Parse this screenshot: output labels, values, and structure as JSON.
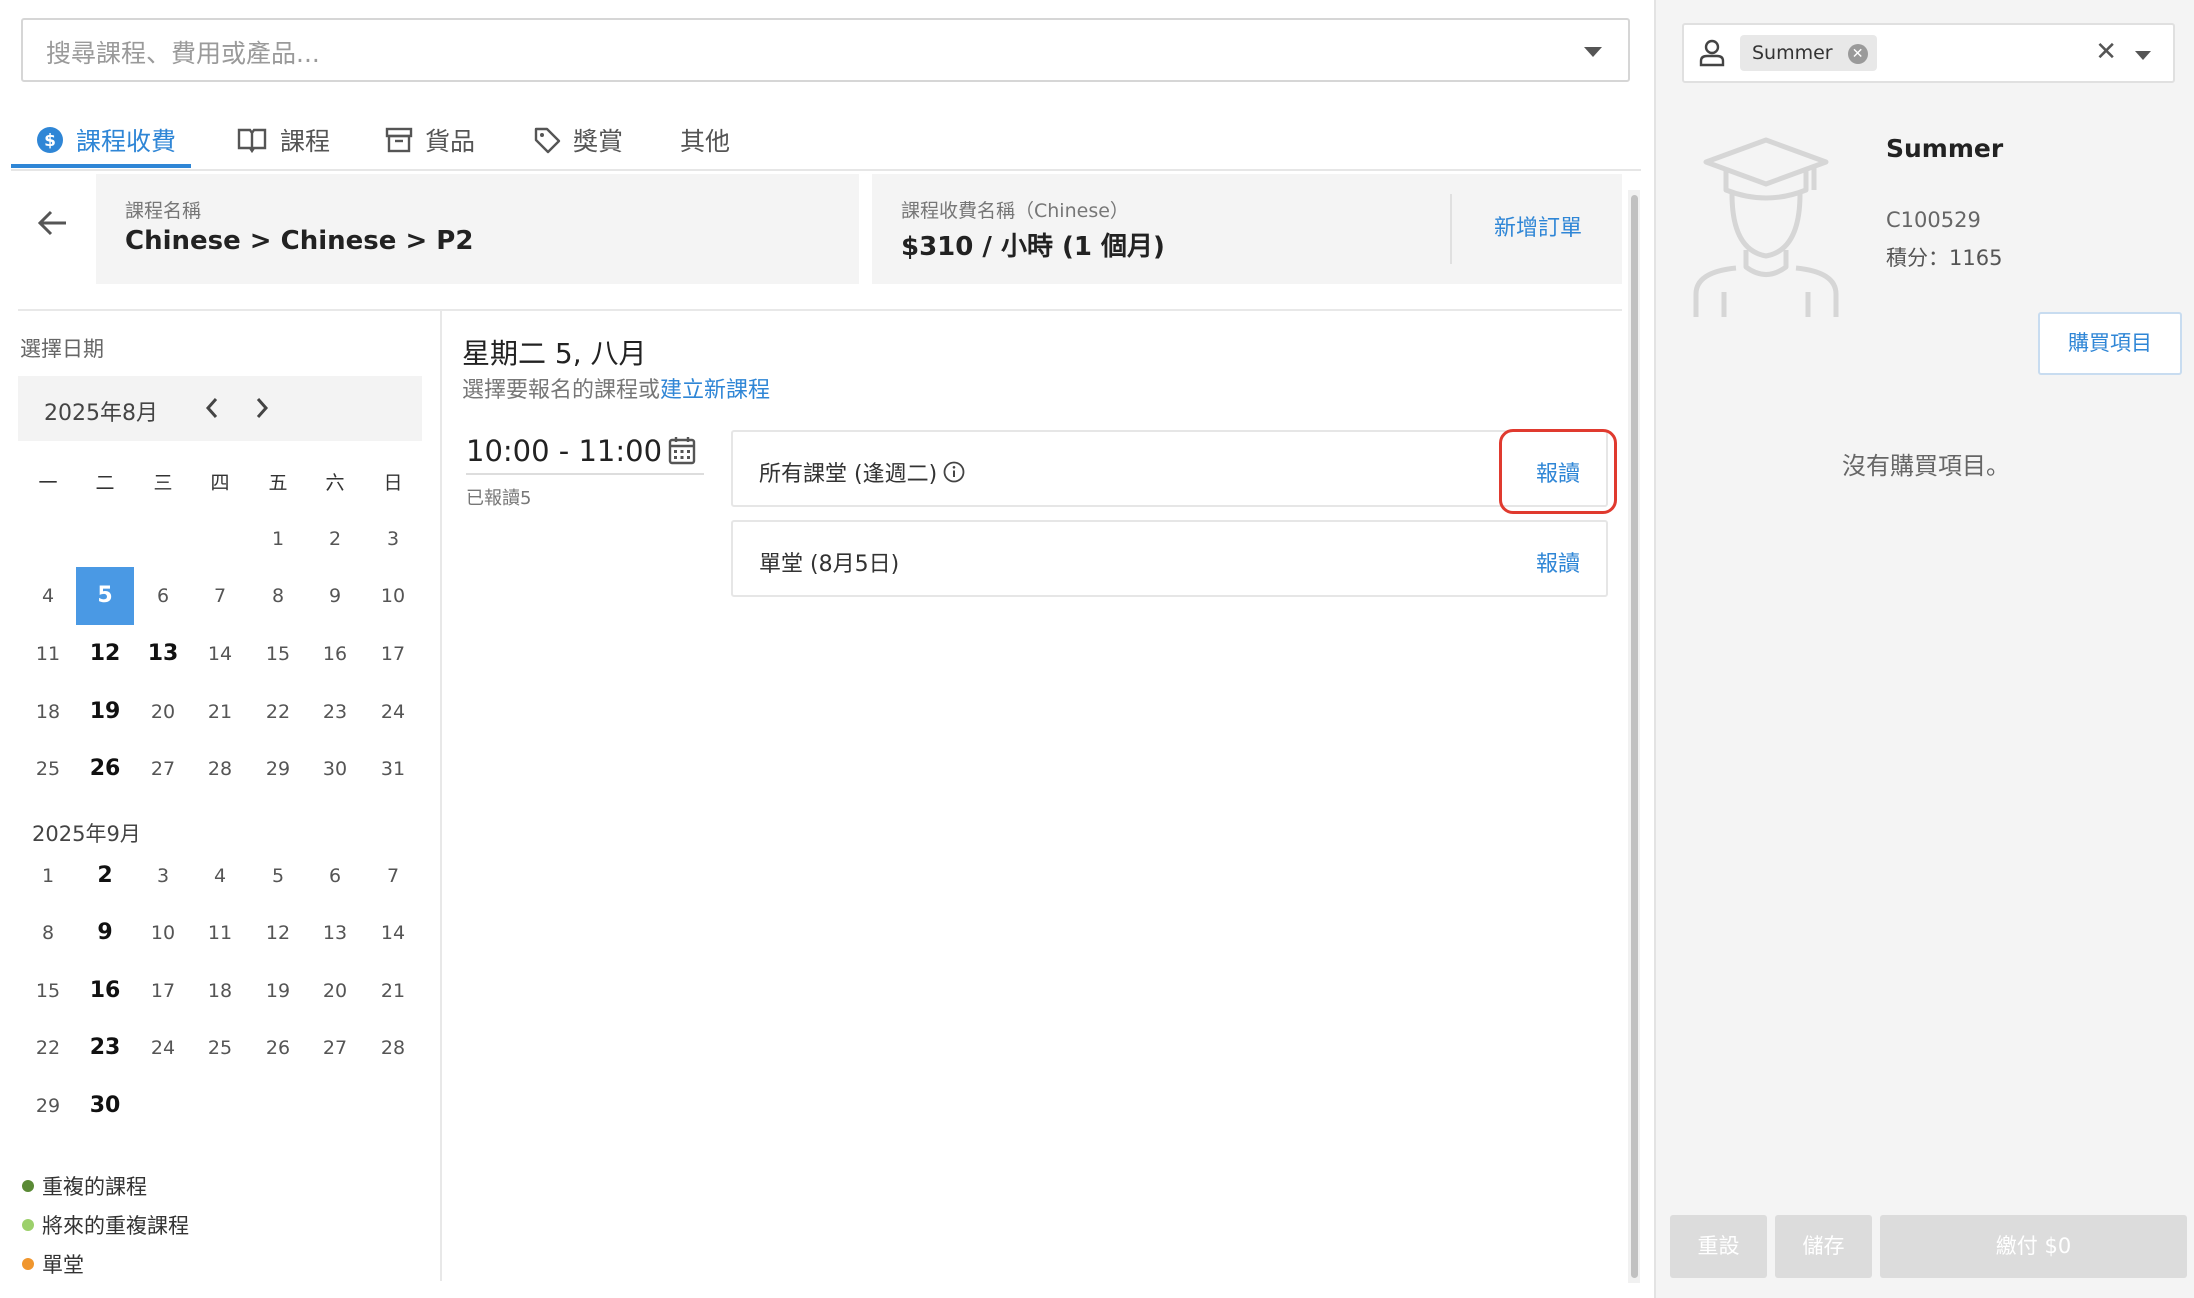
{
  "search": {
    "placeholder": "搜尋課程、費用或產品..."
  },
  "tabs": [
    {
      "label": "課程收費",
      "active": true
    },
    {
      "label": "課程"
    },
    {
      "label": "貨品"
    },
    {
      "label": "獎賞"
    },
    {
      "label": "其他"
    }
  ],
  "course": {
    "label": "課程名稱",
    "value": "Chinese > Chinese > P2"
  },
  "fee": {
    "label": "課程收費名稱（Chinese）",
    "value": "$310 / 小時 (1 個月)",
    "order_button": "新增訂單"
  },
  "calendar": {
    "title": "選擇日期",
    "header_month": "2025年8月",
    "weekdays": [
      "一",
      "二",
      "三",
      "四",
      "五",
      "六",
      "日"
    ],
    "month1": {
      "label": "2025年8月",
      "selected": 5,
      "bold_days": [
        12,
        13,
        19,
        26
      ]
    },
    "month2": {
      "label": "2025年9月",
      "bold_days": [
        2,
        9,
        16,
        23,
        30
      ]
    }
  },
  "legend": [
    {
      "label": "重複的課程",
      "color": "#5a8a35"
    },
    {
      "label": "將來的重複課程",
      "color": "#9cd06b"
    },
    {
      "label": "單堂",
      "color": "#f0962e"
    }
  ],
  "schedule": {
    "date_title": "星期二 5, 八月",
    "subtitle": "選擇要報名的課程或",
    "create_link": "建立新課程",
    "time_range": "10:00 - 11:00",
    "enrolled": "已報讀5",
    "options": [
      {
        "label": "所有課堂 (逢週二)",
        "button": "報讀",
        "info": true
      },
      {
        "label": "單堂 (8月5日)",
        "button": "報讀"
      }
    ]
  },
  "customer": {
    "chip": "Summer",
    "name": "Summer",
    "code": "C100529",
    "points": "積分：1165",
    "buy_button": "購買項目",
    "empty_text": "沒有購買項目。"
  },
  "footer": {
    "reset": "重設",
    "save": "儲存",
    "pay": "繳付 $0"
  }
}
